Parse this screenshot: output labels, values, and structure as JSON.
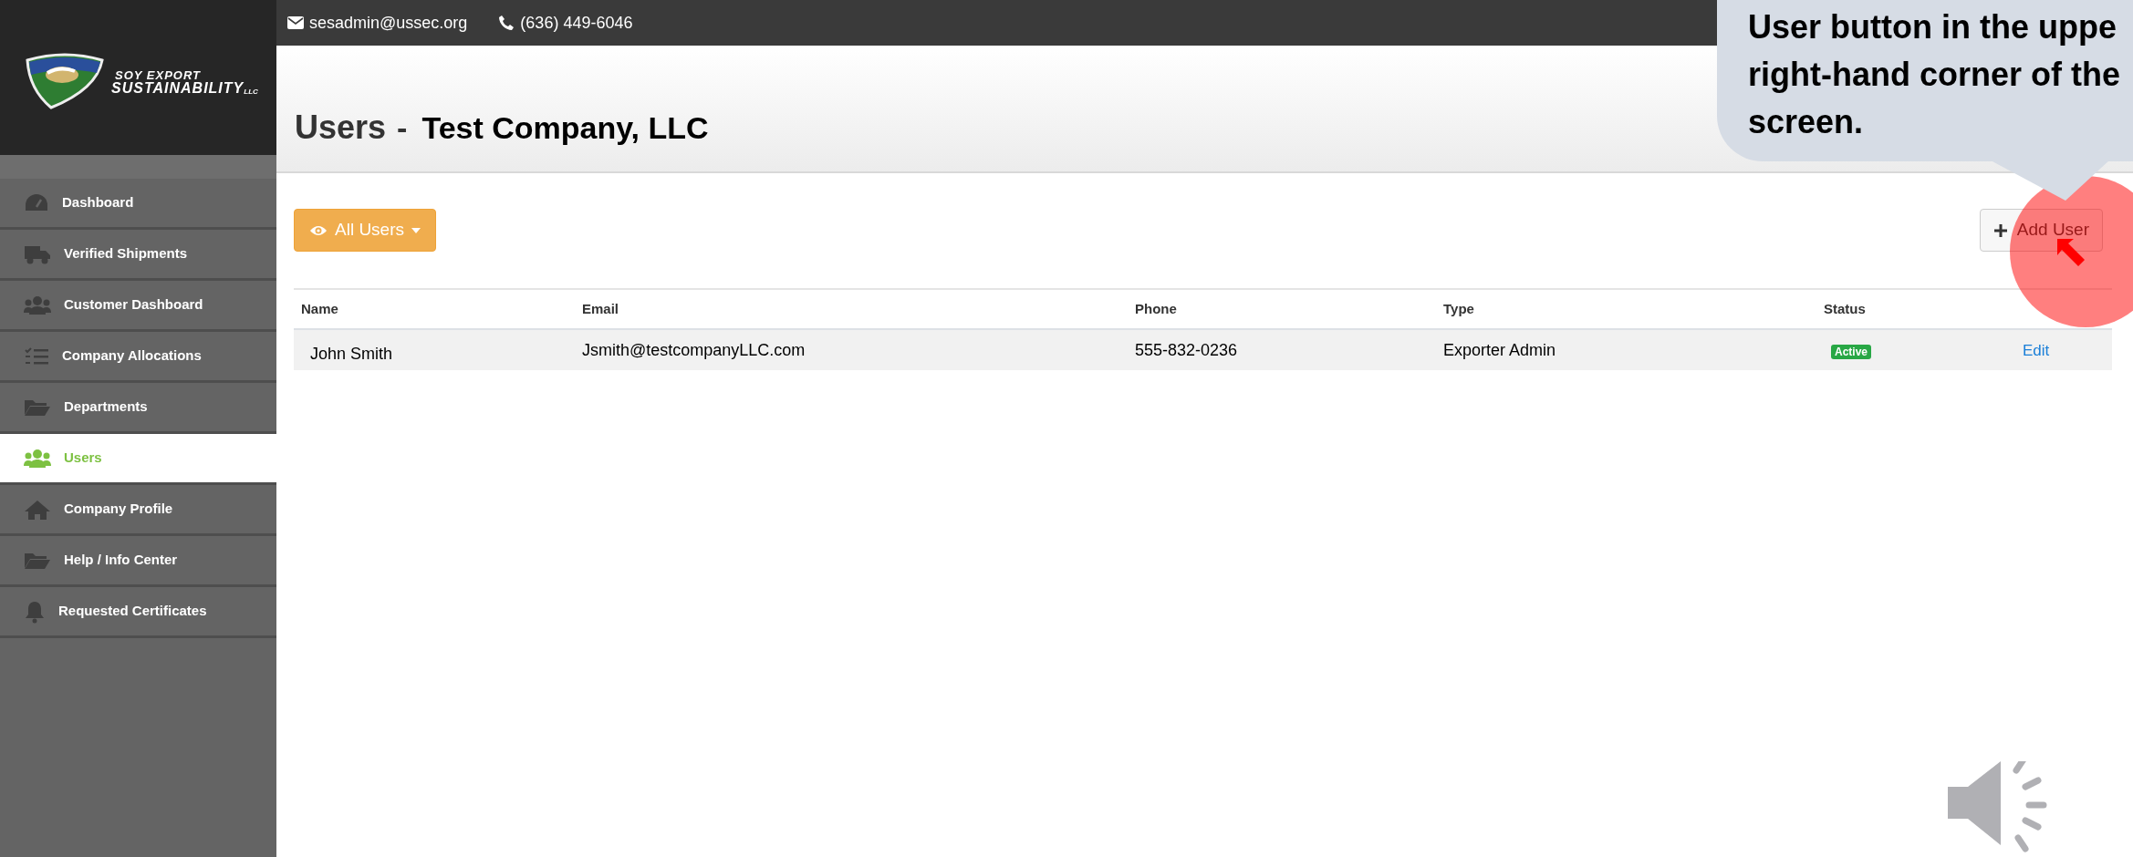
{
  "top_bar": {
    "email": "sesadmin@ussec.org",
    "phone": "(636) 449-6046"
  },
  "logo": {
    "line_1": "SOY EXPORT",
    "line_2": "SUSTAINABILITY",
    "suffix": "LLC"
  },
  "sidebar": {
    "items": [
      {
        "label": "Dashboard",
        "selected": false
      },
      {
        "label": "Verified Shipments",
        "selected": false
      },
      {
        "label": "Customer Dashboard",
        "selected": false
      },
      {
        "label": "Company Allocations",
        "selected": false
      },
      {
        "label": "Departments",
        "selected": false
      },
      {
        "label": "Users",
        "selected": true
      },
      {
        "label": "Company Profile",
        "selected": false
      },
      {
        "label": "Help / Info Center",
        "selected": false
      },
      {
        "label": "Requested Certificates",
        "selected": false
      }
    ]
  },
  "header": {
    "title": "Users",
    "separator": "-",
    "company": "Test Company, LLC"
  },
  "toolbar": {
    "filter_button": "All Users",
    "add_button": "Add User"
  },
  "table": {
    "columns": [
      "Name",
      "Email",
      "Phone",
      "Type",
      "Status"
    ],
    "rows": [
      {
        "name": "John Smith",
        "email": "Jsmith@testcompanyLLC.com",
        "phone": "555-832-0236",
        "type": "Exporter Admin",
        "status": "Active",
        "action": "Edit"
      }
    ]
  },
  "callout": {
    "lines": [
      "User button in the uppe",
      "right-hand corner of the",
      "screen."
    ]
  }
}
